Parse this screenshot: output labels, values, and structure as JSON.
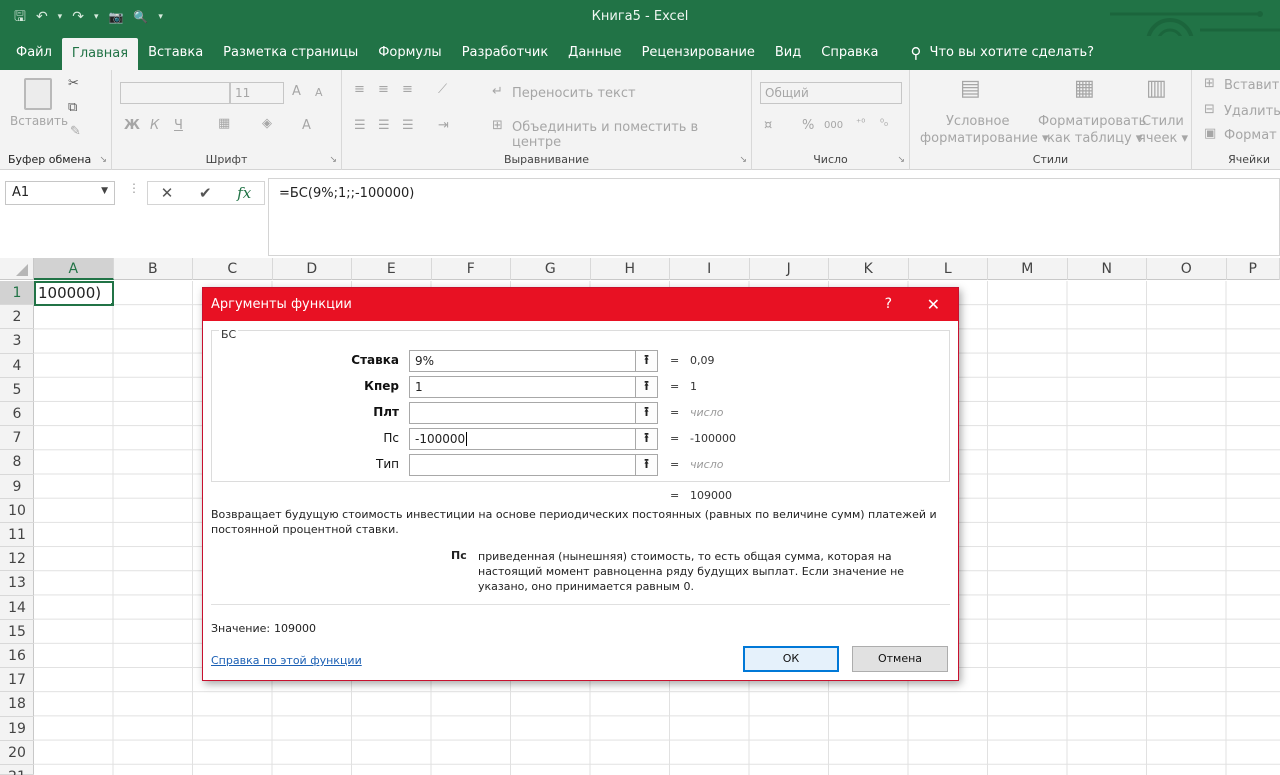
{
  "window": {
    "title": "Книга5  -  Excel"
  },
  "qat": {
    "save": "🖫",
    "undo": "↶",
    "undo_dd": "▾",
    "redo": "↷",
    "redo_dd": "▾",
    "camera": "📷",
    "preview": "🔍",
    "more": "▾"
  },
  "tabs": [
    "Файл",
    "Главная",
    "Вставка",
    "Разметка страницы",
    "Формулы",
    "Разработчик",
    "Данные",
    "Рецензирование",
    "Вид",
    "Справка"
  ],
  "active_tab": "Главная",
  "tell_me": {
    "icon": "lightbulb-icon",
    "text": "Что вы хотите сделать?"
  },
  "ribbon": {
    "clipboard": {
      "paste": "Вставить",
      "label": "Буфер обмена"
    },
    "font": {
      "font_name": "",
      "font_size": "11",
      "bold": "Ж",
      "italic": "К",
      "underline": "Ч",
      "grow": "A",
      "shrink": "A",
      "color": "A",
      "label": "Шрифт"
    },
    "alignment": {
      "wrap": "Переносить текст",
      "merge": "Объединить и поместить в центре",
      "label": "Выравнивание"
    },
    "number": {
      "format": "Общий",
      "percent": "%",
      "thousands": "000",
      "label": "Число"
    },
    "styles": {
      "conditional_1": "Условное",
      "conditional_2": "форматирование ▾",
      "table_1": "Форматировать",
      "table_2": "как таблицу ▾",
      "cell_1": "Стили",
      "cell_2": "ячеек ▾",
      "label": "Стили"
    },
    "cells": {
      "insert": "Вставить",
      "delete": "Удалить",
      "format": "Формат",
      "label": "Ячейки"
    }
  },
  "formula_bar": {
    "name_box": "A1",
    "cancel": "✕",
    "enter": "✔",
    "fx": "fx",
    "formula": "=БС(9%;1;;-100000)"
  },
  "grid": {
    "columns": [
      "A",
      "B",
      "C",
      "D",
      "E",
      "F",
      "G",
      "H",
      "I",
      "J",
      "K",
      "L",
      "M",
      "N",
      "O",
      "P"
    ],
    "rows": [
      "1",
      "2",
      "3",
      "4",
      "5",
      "6",
      "7",
      "8",
      "9",
      "10",
      "11",
      "12",
      "13",
      "14",
      "15",
      "16",
      "17",
      "18",
      "19",
      "20",
      "21"
    ],
    "selected_column": "A",
    "selected_row": "1",
    "a1_text": "100000)"
  },
  "dialog": {
    "title": "Аргументы функции",
    "help": "?",
    "close": "✕",
    "function": "БС",
    "args": [
      {
        "name": "Ставка",
        "value": "9%",
        "result": "0,09",
        "bold": true
      },
      {
        "name": "Кпер",
        "value": "1",
        "result": "1",
        "bold": true
      },
      {
        "name": "Плт",
        "value": "",
        "result": "число",
        "bold": true
      },
      {
        "name": "Пс",
        "value": "-100000",
        "result": "-100000",
        "bold": false
      },
      {
        "name": "Тип",
        "value": "",
        "result": "число",
        "bold": false
      }
    ],
    "eq": "=",
    "ref_icon": "⭱",
    "overall_result": "109000",
    "description": "Возвращает будущую стоимость инвестиции на основе периодических постоянных (равных по величине сумм) платежей и постоянной процентной ставки.",
    "arg_name": "Пс",
    "arg_description": "приведенная (нынешняя) стоимость, то есть общая сумма, которая на настоящий момент равноценна ряду будущих выплат. Если значение не указано, оно принимается равным 0.",
    "value_label": "Значение:",
    "value": "109000",
    "help_link": "Справка по этой функции",
    "ok": "ОК",
    "cancel": "Отмена"
  }
}
